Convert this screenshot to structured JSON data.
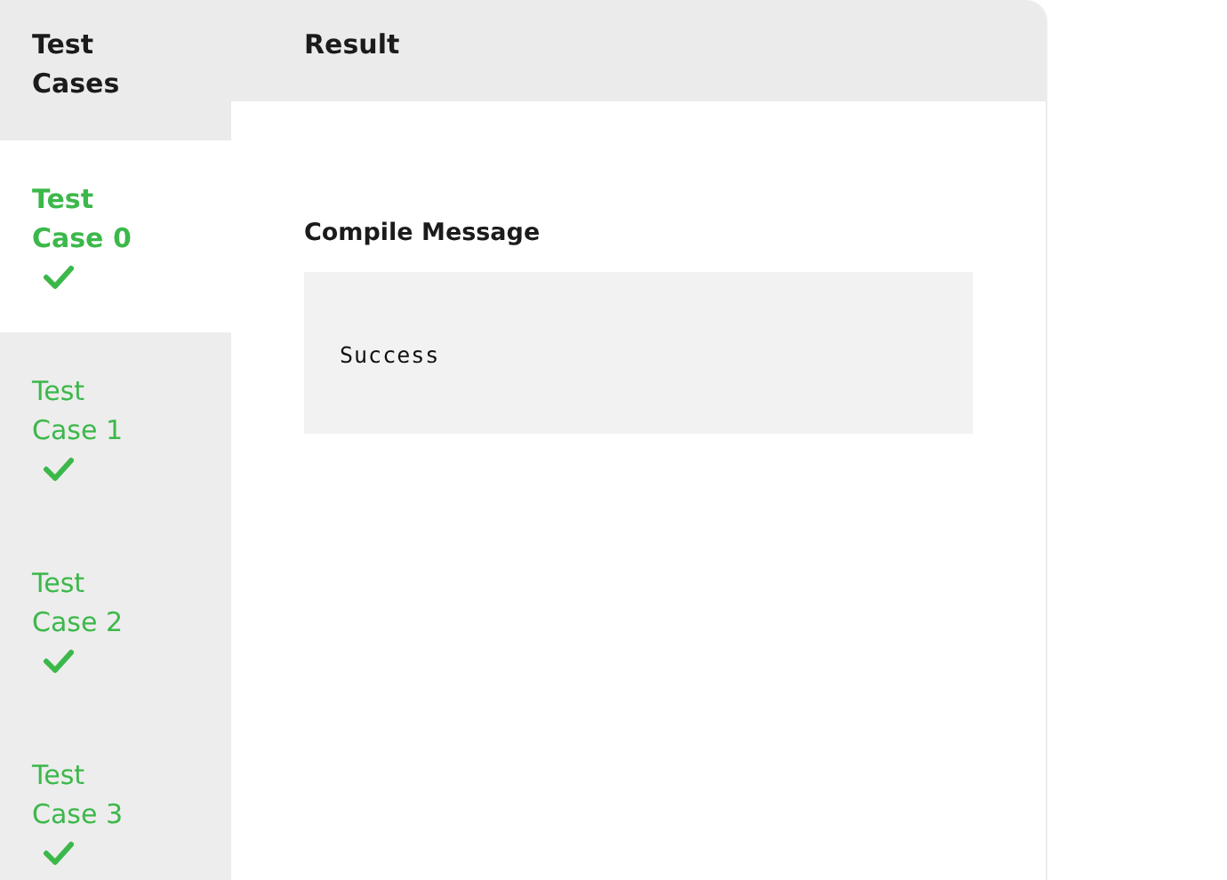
{
  "sidebar": {
    "title": "Test Cases",
    "items": [
      {
        "label": "Test Case 0",
        "selected": true,
        "passed": true
      },
      {
        "label": "Test Case 1",
        "selected": false,
        "passed": true
      },
      {
        "label": "Test Case 2",
        "selected": false,
        "passed": true
      },
      {
        "label": "Test Case 3",
        "selected": false,
        "passed": true
      }
    ]
  },
  "result": {
    "title": "Result",
    "compile_message": {
      "heading": "Compile Message",
      "output": "Success"
    }
  }
}
